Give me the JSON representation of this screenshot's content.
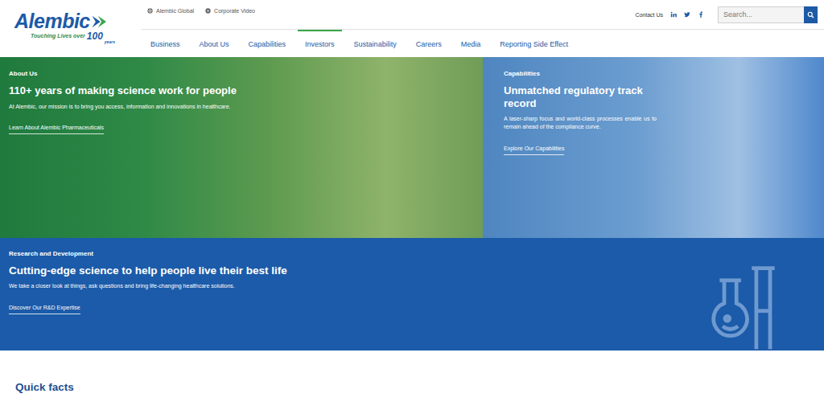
{
  "logo": {
    "name": "Alembic",
    "tagline": "Touching Lives over",
    "years": "100",
    "years_label": "years"
  },
  "top_links": [
    {
      "label": "Alembic Global",
      "kind": "globe"
    },
    {
      "label": "Corporate Video",
      "kind": "video"
    }
  ],
  "utility": {
    "contact": "Contact Us"
  },
  "search": {
    "placeholder": "Search..."
  },
  "nav": [
    {
      "label": "Business",
      "selected": false
    },
    {
      "label": "About Us",
      "selected": false
    },
    {
      "label": "Capabilities",
      "selected": false
    },
    {
      "label": "Investors",
      "selected": true
    },
    {
      "label": "Sustainability",
      "selected": false
    },
    {
      "label": "Careers",
      "selected": false
    },
    {
      "label": "Media",
      "selected": false
    },
    {
      "label": "Reporting Side Effect",
      "selected": false
    }
  ],
  "hero": [
    {
      "eyebrow": "About Us",
      "title": "110+ years of making science work for people",
      "body": "At Alembic, our mission is to bring you access, information and innovations in healthcare.",
      "link": "Learn About Alembic Pharmaceuticals",
      "kind": "green"
    },
    {
      "eyebrow": "Capabilities",
      "title": "Unmatched regulatory track record",
      "body": "A laser-sharp focus and world-class processes enable us to remain ahead of the compliance curve.",
      "link": "Explore Our Capabilities",
      "kind": "blue"
    }
  ],
  "rd": {
    "eyebrow": "Research and Development",
    "title": "Cutting-edge science to help people live their best life",
    "body": "We take a closer look at things, ask questions and bring life-changing healthcare solutions.",
    "link": "Discover Our R&D Expertise"
  },
  "quick_facts": {
    "title": "Quick facts"
  }
}
